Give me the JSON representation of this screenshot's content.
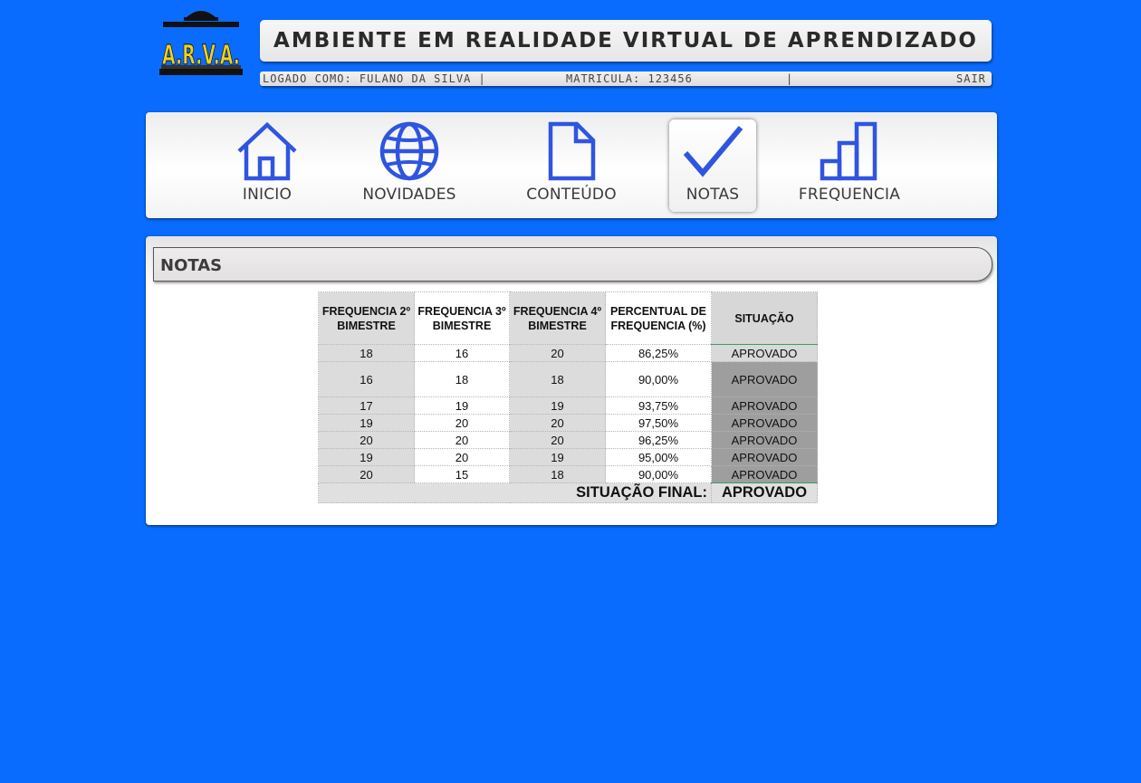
{
  "app": {
    "logo_text": "A.R.V.A.",
    "title": "AMBIENTE EM REALIDADE VIRTUAL DE APRENDIZADO"
  },
  "status": {
    "logged_as": "LOGADO COMO: FULANO DA SILVA  |",
    "matricula": "MATRICULA: 123456",
    "separator": "|",
    "logout": "SAIR"
  },
  "nav": {
    "items": [
      {
        "label": "INICIO",
        "icon": "home-icon"
      },
      {
        "label": "NOVIDADES",
        "icon": "globe-icon"
      },
      {
        "label": "CONTEÚDO",
        "icon": "document-icon"
      },
      {
        "label": "NOTAS",
        "icon": "checkmark-icon",
        "active": true
      },
      {
        "label": "FREQUENCIA",
        "icon": "bar-chart-icon"
      }
    ]
  },
  "section": {
    "title": "NOTAS"
  },
  "table": {
    "headers": [
      "FREQUENCIA 2º BIMESTRE",
      "FREQUENCIA 3º BIMESTRE",
      "FREQUENCIA 4º BIMESTRE",
      "PERCENTUAL DE FREQUENCIA (%)",
      "SITUAÇÃO"
    ],
    "header_lines": [
      [
        "FREQUENCIA 2º",
        "BIMESTRE"
      ],
      [
        "FREQUENCIA 3º",
        "BIMESTRE"
      ],
      [
        "FREQUENCIA 4º",
        "BIMESTRE"
      ],
      [
        "PERCENTUAL DE",
        "FREQUENCIA (%)"
      ],
      [
        "SITUAÇÃO",
        ""
      ]
    ],
    "rows": [
      [
        "18",
        "16",
        "20",
        "86,25%",
        "APROVADO"
      ],
      [
        "16",
        "18",
        "18",
        "90,00%",
        "APROVADO"
      ],
      [
        "17",
        "19",
        "19",
        "93,75%",
        "APROVADO"
      ],
      [
        "19",
        "20",
        "20",
        "97,50%",
        "APROVADO"
      ],
      [
        "20",
        "20",
        "20",
        "96,25%",
        "APROVADO"
      ],
      [
        "19",
        "20",
        "19",
        "95,00%",
        "APROVADO"
      ],
      [
        "20",
        "15",
        "18",
        "90,00%",
        "APROVADO"
      ]
    ],
    "final_label": "SITUAÇÃO FINAL:",
    "final_value": "APROVADO"
  },
  "colors": {
    "background": "#0a6cfe",
    "icon_blue": "#2f55e0",
    "logo_yellow": "#f2d21a"
  }
}
